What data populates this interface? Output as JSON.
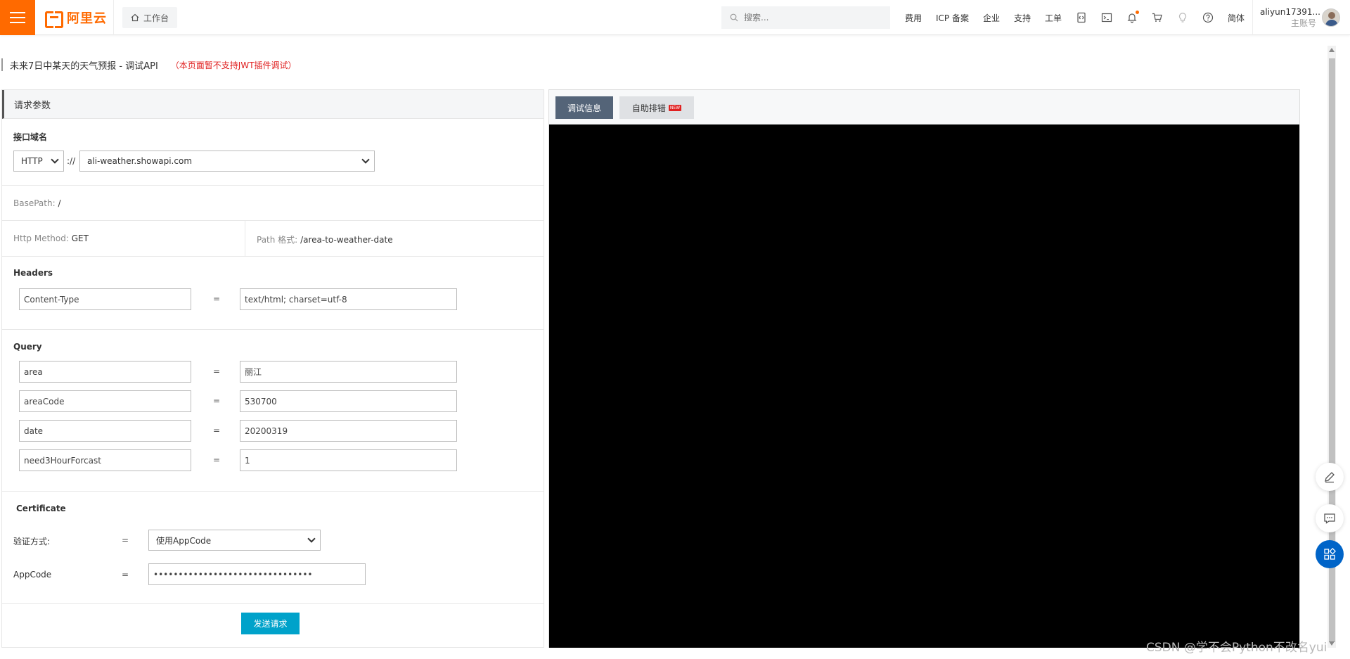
{
  "topbar": {
    "logo_text": "阿里云",
    "workbench_label": "工作台",
    "search_placeholder": "搜索...",
    "nav_items": [
      "费用",
      "ICP 备案",
      "企业",
      "支持",
      "工单"
    ],
    "lang_label": "简体",
    "user_name": "aliyun17391...",
    "user_role": "主账号"
  },
  "page": {
    "title": "未来7日中某天的天气预报 - 调试API",
    "warning": "（本页面暂不支持JWT插件调试）"
  },
  "request": {
    "header": "请求参数",
    "domain_section": {
      "label": "接口域名",
      "protocol": "HTTP",
      "separator": "://",
      "host": "ali-weather.showapi.com"
    },
    "basepath": {
      "label": "BasePath:",
      "value": "/"
    },
    "method": {
      "label": "Http Method:",
      "value": "GET"
    },
    "path": {
      "label": "Path 格式:",
      "value": "/area-to-weather-date"
    },
    "headers": {
      "label": "Headers",
      "rows": [
        {
          "key": "Content-Type",
          "eq": "=",
          "value": "text/html; charset=utf-8"
        }
      ]
    },
    "query": {
      "label": "Query",
      "rows": [
        {
          "key": "area",
          "eq": "=",
          "value": "丽江"
        },
        {
          "key": "areaCode",
          "eq": "=",
          "value": "530700"
        },
        {
          "key": "date",
          "eq": "=",
          "value": "20200319"
        },
        {
          "key": "need3HourForcast",
          "eq": "=",
          "value": "1"
        }
      ]
    },
    "certificate": {
      "label": "Certificate",
      "auth_label": "验证方式:",
      "auth_eq": "=",
      "auth_value": "使用AppCode",
      "appcode_label": "AppCode",
      "appcode_eq": "=",
      "appcode_value": "••••••••••••••••••••••••••••••••"
    },
    "send_button": "发送请求"
  },
  "debug": {
    "tab_active": "调试信息",
    "tab_other": "自助排错",
    "new_badge": "NEW"
  },
  "watermark": "CSDN @学不会Python不改名yui",
  "colors": {
    "brand": "#ff6a00",
    "send": "#00a2ca",
    "tab_active": "#546478",
    "warning": "#e02020",
    "float_blue": "#0064c8"
  }
}
